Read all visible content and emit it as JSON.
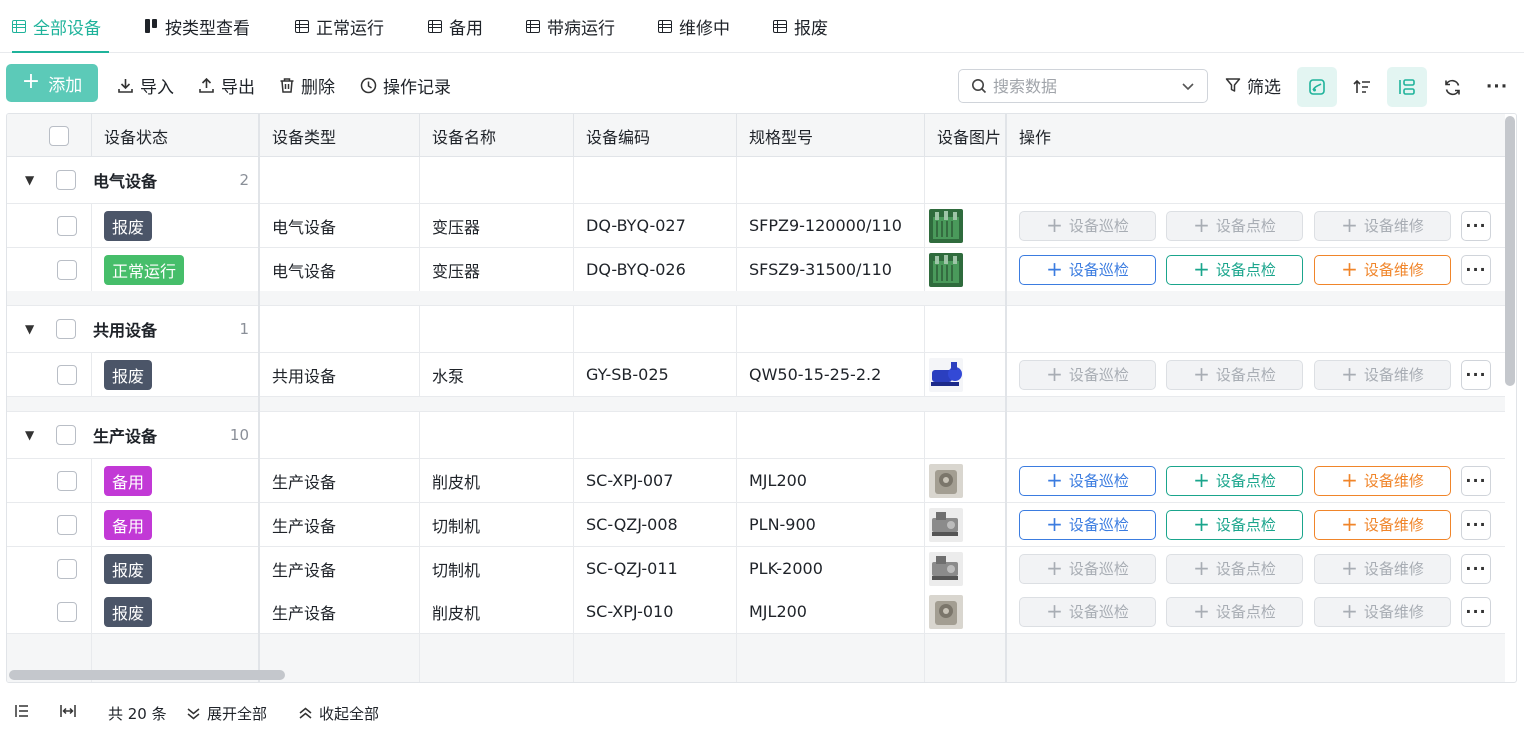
{
  "tabs": [
    {
      "label": "全部设备",
      "icon": "table-icon",
      "active": true
    },
    {
      "label": "按类型查看",
      "icon": "kanban-icon",
      "active": false
    },
    {
      "label": "正常运行",
      "icon": "table-icon",
      "active": false
    },
    {
      "label": "备用",
      "icon": "table-icon",
      "active": false
    },
    {
      "label": "带病运行",
      "icon": "table-icon",
      "active": false
    },
    {
      "label": "维修中",
      "icon": "table-icon",
      "active": false
    },
    {
      "label": "报废",
      "icon": "table-icon",
      "active": false
    }
  ],
  "toolbar": {
    "add": "添加",
    "import": "导入",
    "export": "导出",
    "delete": "删除",
    "log": "操作记录",
    "search_placeholder": "搜索数据",
    "filter": "筛选"
  },
  "columns": [
    "设备状态",
    "设备类型",
    "设备名称",
    "设备编码",
    "规格型号",
    "设备图片",
    "操作"
  ],
  "actions": {
    "inspect": "设备巡检",
    "check": "设备点检",
    "repair": "设备维修"
  },
  "groups": [
    {
      "name": "电气设备",
      "count": "2",
      "rows": [
        {
          "status": "报废",
          "type": "电气设备",
          "name": "变压器",
          "code": "DQ-BYQ-027",
          "spec": "SFPZ9-120000/110",
          "image": "transformer",
          "enabled": false
        },
        {
          "status": "正常运行",
          "type": "电气设备",
          "name": "变压器",
          "code": "DQ-BYQ-026",
          "spec": "SFSZ9-31500/110",
          "image": "transformer",
          "enabled": true
        }
      ]
    },
    {
      "name": "共用设备",
      "count": "1",
      "rows": [
        {
          "status": "报废",
          "type": "共用设备",
          "name": "水泵",
          "code": "GY-SB-025",
          "spec": "QW50-15-25-2.2",
          "image": "pump",
          "enabled": false
        }
      ]
    },
    {
      "name": "生产设备",
      "count": "10",
      "rows": [
        {
          "status": "备用",
          "type": "生产设备",
          "name": "削皮机",
          "code": "SC-XPJ-007",
          "spec": "MJL200",
          "image": "peeler",
          "enabled": true
        },
        {
          "status": "备用",
          "type": "生产设备",
          "name": "切制机",
          "code": "SC-QZJ-008",
          "spec": "PLN-900",
          "image": "cutter",
          "enabled": true
        },
        {
          "status": "报废",
          "type": "生产设备",
          "name": "切制机",
          "code": "SC-QZJ-011",
          "spec": "PLK-2000",
          "image": "cutter",
          "enabled": false
        },
        {
          "status": "报废",
          "type": "生产设备",
          "name": "削皮机",
          "code": "SC-XPJ-010",
          "spec": "MJL200",
          "image": "peeler",
          "enabled": false
        }
      ]
    }
  ],
  "status_colors": {
    "报废": "#4b5568",
    "正常运行": "#46be6a",
    "备用": "#c239d6"
  },
  "footer": {
    "total": "共 20 条",
    "expand": "展开全部",
    "collapse": "收起全部"
  },
  "colors": {
    "accent": "#1fb39b",
    "add_button": "#5ccab8",
    "inspect": "#3b7ce0",
    "check": "#1aa58c",
    "repair": "#f0852a"
  }
}
